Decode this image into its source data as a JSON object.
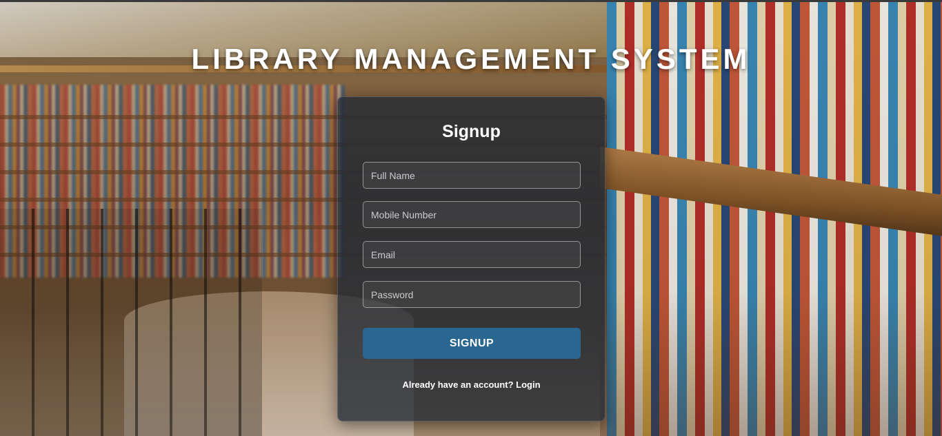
{
  "page": {
    "title": "LIBRARY MANAGEMENT SYSTEM"
  },
  "signup_form": {
    "heading": "Signup",
    "fields": {
      "full_name": {
        "placeholder": "Full Name",
        "value": ""
      },
      "mobile": {
        "placeholder": "Mobile Number",
        "value": ""
      },
      "email": {
        "placeholder": "Email",
        "value": ""
      },
      "password": {
        "placeholder": "Password",
        "value": ""
      }
    },
    "submit_label": "SIGNUP",
    "footer_text": "Already have an account?",
    "login_link": "Login"
  },
  "colors": {
    "card_background": "#232a34",
    "button": "#2a6790",
    "text": "#ffffff"
  },
  "background": {
    "description_icon": "library-bookshelves-photo"
  }
}
